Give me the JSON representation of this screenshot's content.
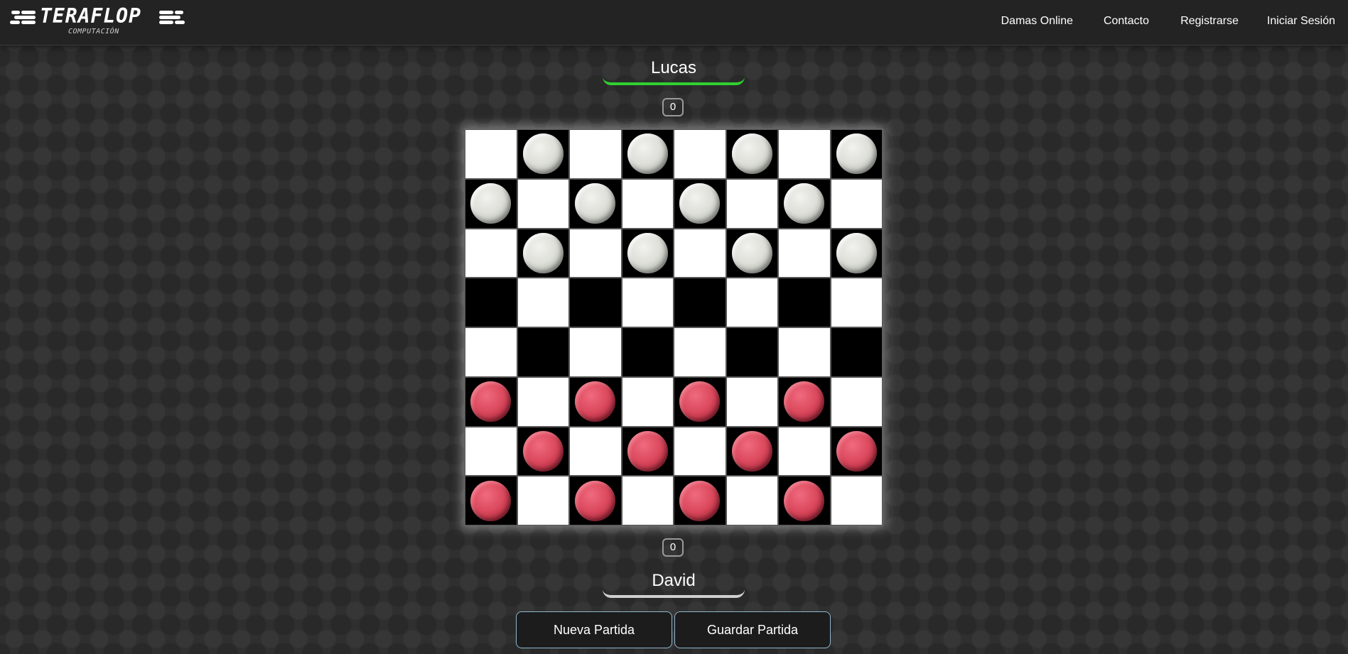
{
  "header": {
    "logo_title": "TERAFLOP",
    "logo_subtitle": "COMPUTACIÓN",
    "nav": [
      {
        "label": "Damas Online"
      },
      {
        "label": "Contacto"
      },
      {
        "label": "Registrarse"
      },
      {
        "label": "Iniciar Sesión"
      }
    ]
  },
  "game": {
    "top_player": {
      "name": "Lucas",
      "score": "0",
      "indicator_color": "#2fd12f"
    },
    "bottom_player": {
      "name": "David",
      "score": "0",
      "indicator_color": "#cfcfcf"
    },
    "board": {
      "rows": [
        "_w_w_w_w",
        "w_w_w_w_",
        "_w_w_w_w",
        "________",
        "________",
        "r_r_r_r_",
        "_r_r_r_r",
        "r_r_r_r_"
      ],
      "dark_square_color": "#000000",
      "light_square_color": "#ffffff",
      "white_piece_color": "#dedfd9",
      "red_piece_color": "#dc4a5e"
    }
  },
  "actions": {
    "new_game_label": "Nueva Partida",
    "save_game_label": "Guardar Partida"
  }
}
